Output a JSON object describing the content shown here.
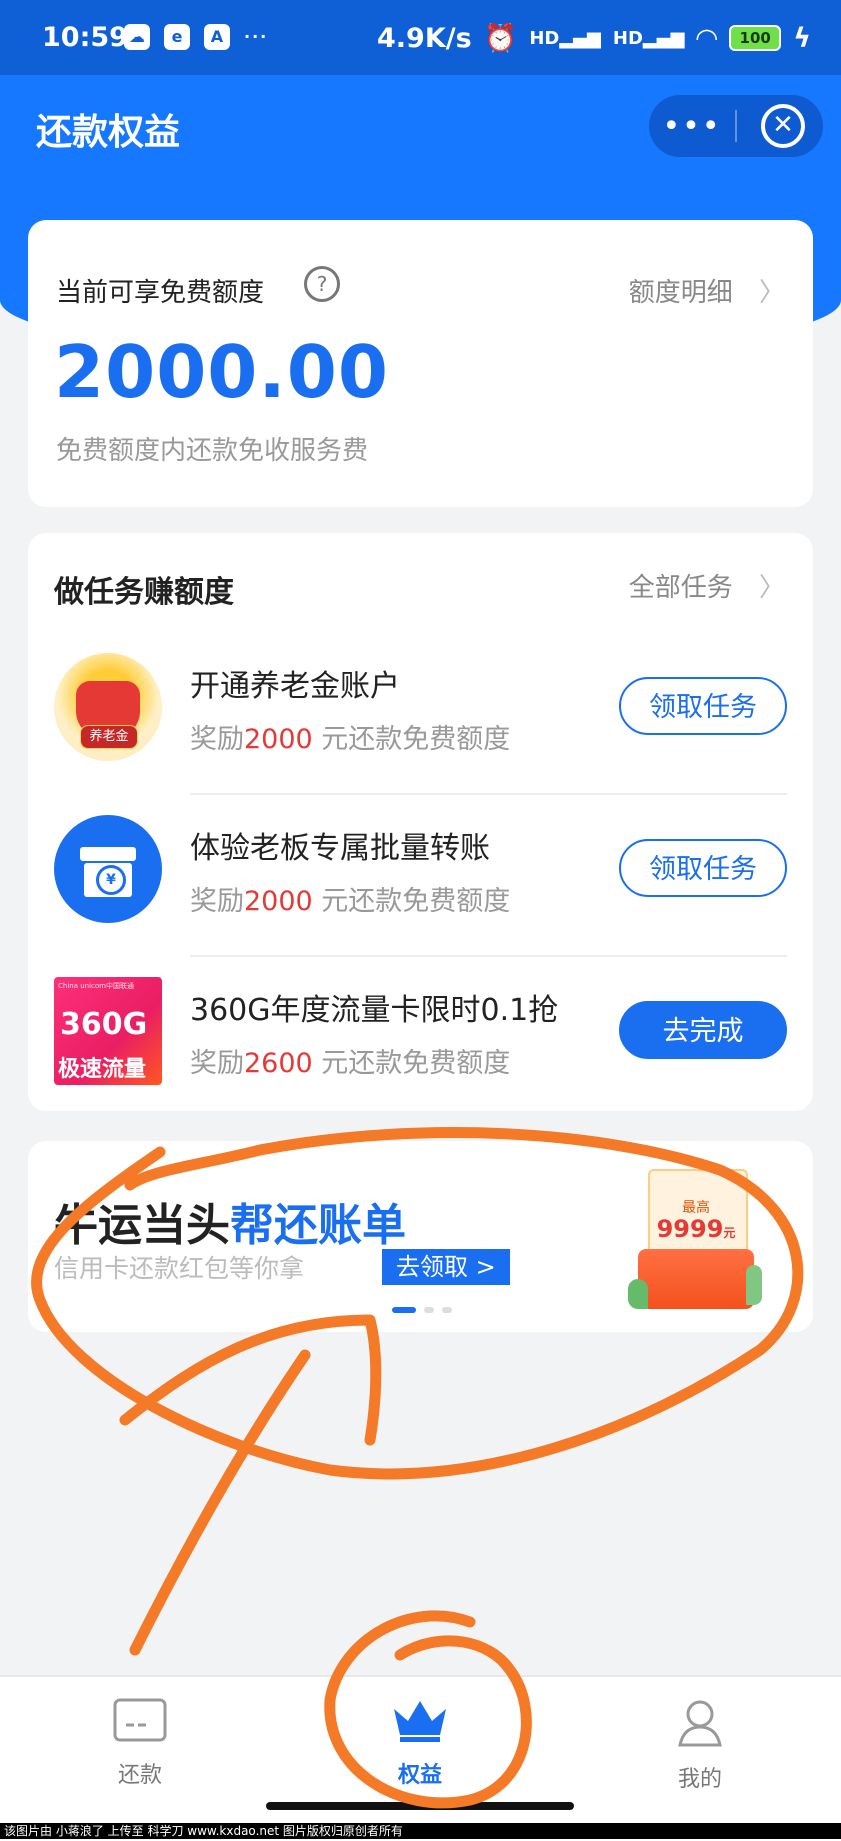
{
  "status_bar": {
    "time": "10:59",
    "app_icons": [
      "cloud-app-icon",
      "browser-app-icon",
      "translate-app-icon"
    ],
    "more": "···",
    "speed": "4.9K/s",
    "signal_labels": [
      "HD",
      "HD"
    ],
    "battery": "100"
  },
  "header": {
    "title": "还款权益",
    "more_glyph": "•••",
    "close_glyph": "✕"
  },
  "quota": {
    "label": "当前可享免费额度",
    "help_glyph": "?",
    "detail_link": "额度明细",
    "amount": "2000.00",
    "note": "免费额度内还款免收服务费"
  },
  "tasks": {
    "heading": "做任务赚额度",
    "all_link": "全部任务",
    "items": [
      {
        "name": "开通养老金账户",
        "reward_prefix": "奖励",
        "reward_amount": "2000",
        "reward_suffix": " 元还款免费额度",
        "button": "领取任务",
        "icon_text": "养老金"
      },
      {
        "name": "体验老板专属批量转账",
        "reward_prefix": "奖励",
        "reward_amount": "2000",
        "reward_suffix": " 元还款免费额度",
        "button": "领取任务",
        "icon_text": "¥"
      },
      {
        "name": "360G年度流量卡限时0.1抢",
        "reward_prefix": "奖励",
        "reward_amount": "2600",
        "reward_suffix": " 元还款免费额度",
        "button": "去完成",
        "icon_text_1": "China unicom中国联通",
        "icon_text_2": "360G",
        "icon_text_3": "极速流量"
      }
    ]
  },
  "banner": {
    "title_plain": "牛运当头",
    "title_highlight": "帮还账单",
    "subtitle": "信用卡还款红包等你拿",
    "cta": "去领取 >",
    "prize_top": "最高",
    "prize_amount": "9999",
    "prize_unit": "元",
    "pager_count": 3,
    "pager_active": 1
  },
  "tabbar": {
    "tabs": [
      {
        "label": "还款",
        "icon": "card-icon",
        "active": false
      },
      {
        "label": "权益",
        "icon": "crown-icon",
        "active": true
      },
      {
        "label": "我的",
        "icon": "person-icon",
        "active": false
      }
    ]
  },
  "watermark": "该图片由 小蒋浪了 上传至 科学刀 www.kxdao.net 图片版权归原创者所有",
  "colors": {
    "brand_blue": "#1677ff",
    "accent_red": "#e53935",
    "annotation_orange": "#f47a28"
  }
}
